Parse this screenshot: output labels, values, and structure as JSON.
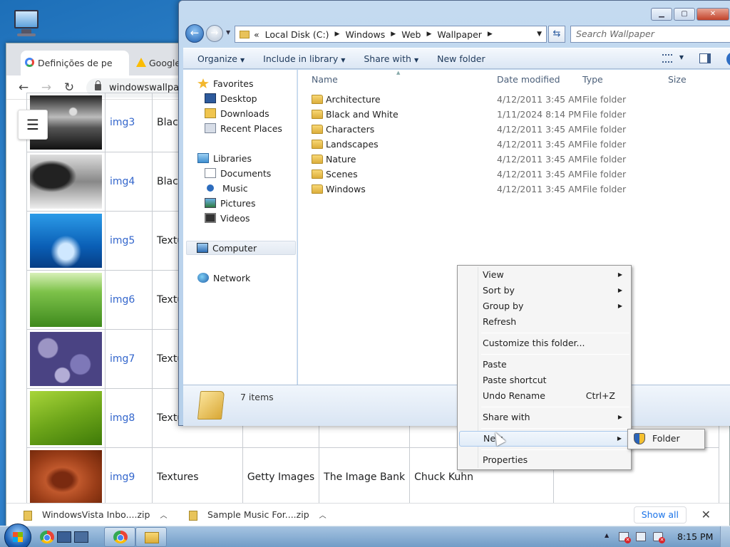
{
  "chrome": {
    "tabs": [
      "Definições de pe",
      "Google"
    ],
    "url": "windowswallpap",
    "table_rows": [
      {
        "name": "img3",
        "category": "Black and White",
        "thumb": "th-img3"
      },
      {
        "name": "img4",
        "category": "Black and White",
        "thumb": "th-img4"
      },
      {
        "name": "img5",
        "category": "Textures",
        "thumb": "th-img5"
      },
      {
        "name": "img6",
        "category": "Textures",
        "thumb": "th-img6"
      },
      {
        "name": "img7",
        "category": "Textures",
        "thumb": "th-img7"
      },
      {
        "name": "img8",
        "category": "Textures",
        "thumb": "th-img8"
      },
      {
        "name": "img9",
        "category": "Textures",
        "thumb": "th-img9",
        "c3": "Getty Images",
        "c4": "The Image Bank",
        "c5": "Chuck Kuhn"
      }
    ],
    "downloads": [
      "WindowsVista Inbo....zip",
      "Sample Music For....zip"
    ],
    "show_all": "Show all"
  },
  "explorer": {
    "address": {
      "prefix": "«",
      "crumbs": [
        "Local Disk (C:)",
        "Windows",
        "Web",
        "Wallpaper"
      ]
    },
    "search_placeholder": "Search Wallpaper",
    "commands": [
      "Organize",
      "Include in library",
      "Share with",
      "New folder"
    ],
    "nav": {
      "favorites": "Favorites",
      "fav_items": [
        "Desktop",
        "Downloads",
        "Recent Places"
      ],
      "libraries": "Libraries",
      "lib_items": [
        "Documents",
        "Music",
        "Pictures",
        "Videos"
      ],
      "computer": "Computer",
      "network": "Network"
    },
    "columns": [
      "Name",
      "Date modified",
      "Type",
      "Size"
    ],
    "files": [
      {
        "name": "Architecture",
        "date": "4/12/2011 3:45 AM",
        "type": "File folder"
      },
      {
        "name": "Black and White",
        "date": "1/11/2024 8:14 PM",
        "type": "File folder"
      },
      {
        "name": "Characters",
        "date": "4/12/2011 3:45 AM",
        "type": "File folder"
      },
      {
        "name": "Landscapes",
        "date": "4/12/2011 3:45 AM",
        "type": "File folder"
      },
      {
        "name": "Nature",
        "date": "4/12/2011 3:45 AM",
        "type": "File folder"
      },
      {
        "name": "Scenes",
        "date": "4/12/2011 3:45 AM",
        "type": "File folder"
      },
      {
        "name": "Windows",
        "date": "4/12/2011 3:45 AM",
        "type": "File folder"
      }
    ],
    "item_count": "7 items"
  },
  "context_menu": {
    "view": "View",
    "sort_by": "Sort by",
    "group_by": "Group by",
    "refresh": "Refresh",
    "customize": "Customize this folder...",
    "paste": "Paste",
    "paste_shortcut": "Paste shortcut",
    "undo_rename": "Undo Rename",
    "undo_shortcut": "Ctrl+Z",
    "share_with": "Share with",
    "new": "New",
    "properties": "Properties",
    "submenu_folder": "Folder"
  },
  "taskbar": {
    "clock": "8:15 PM"
  },
  "colors": {
    "accent": "#2a5b9f",
    "link": "#3366cc",
    "folder": "#dcae3b"
  }
}
